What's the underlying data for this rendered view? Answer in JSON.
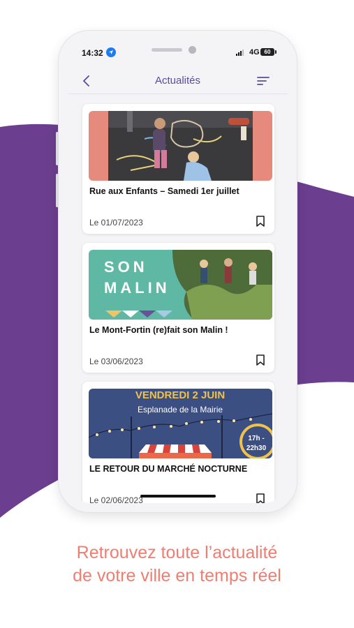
{
  "colors": {
    "brand_purple": "#6b3e8f",
    "caption_coral": "#ee7e72",
    "title_purple": "#5b4a9a",
    "ios_blue": "#1e7bf2"
  },
  "status_bar": {
    "time": "14:32",
    "network": "4G",
    "battery": "60",
    "location_icon": "location-arrow-icon"
  },
  "nav": {
    "title": "Actualités",
    "back_icon": "chevron-left-icon",
    "filter_icon": "sort-lines-icon"
  },
  "news": [
    {
      "image": "photo-children-chalk-drawing",
      "title": "Rue aux Enfants – Samedi 1er juillet",
      "date": "Le 01/07/2023",
      "bookmark_icon": "bookmark-icon"
    },
    {
      "image": "banner-son-malin",
      "image_text_line1": "SON",
      "image_text_line2": "MALIN",
      "title": "Le Mont-Fortin (re)fait son Malin !",
      "date": "Le 03/06/2023",
      "bookmark_icon": "bookmark-icon"
    },
    {
      "image": "banner-marche-nocturne",
      "image_headline": "Vendredi 2 juin",
      "image_subline": "Esplanade de la Mairie",
      "image_time_1": "17h -",
      "image_time_2": "22h30",
      "title": "LE RETOUR DU MARCHÉ NOCTURNE",
      "date": "Le 02/06/2023",
      "bookmark_icon": "bookmark-icon"
    }
  ],
  "caption": {
    "line1": "Retrouvez toute l’actualité",
    "line2": "de votre ville en temps réel"
  }
}
